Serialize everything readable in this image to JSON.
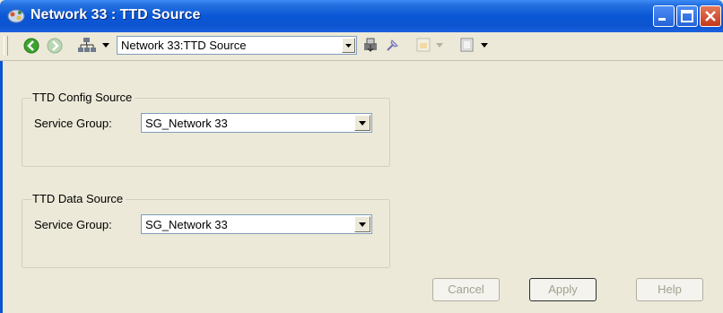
{
  "window": {
    "title": "Network 33 : TTD Source"
  },
  "toolbar": {
    "address_value": "Network 33:TTD Source",
    "icons": [
      "back-icon",
      "forward-icon",
      "network-icon",
      "print-icon",
      "pin-icon",
      "view-icon",
      "page-icon"
    ]
  },
  "groups": [
    {
      "title": "TTD Config Source",
      "label": "Service Group:",
      "value": "SG_Network 33"
    },
    {
      "title": "TTD Data Source",
      "label": "Service Group:",
      "value": "SG_Network 33"
    }
  ],
  "buttons": {
    "cancel": "Cancel",
    "apply": "Apply",
    "help": "Help"
  },
  "colors": {
    "titlebar": "#0d54d0",
    "dialog_bg": "#ece9d8",
    "disabled_text": "#a3a18f"
  }
}
